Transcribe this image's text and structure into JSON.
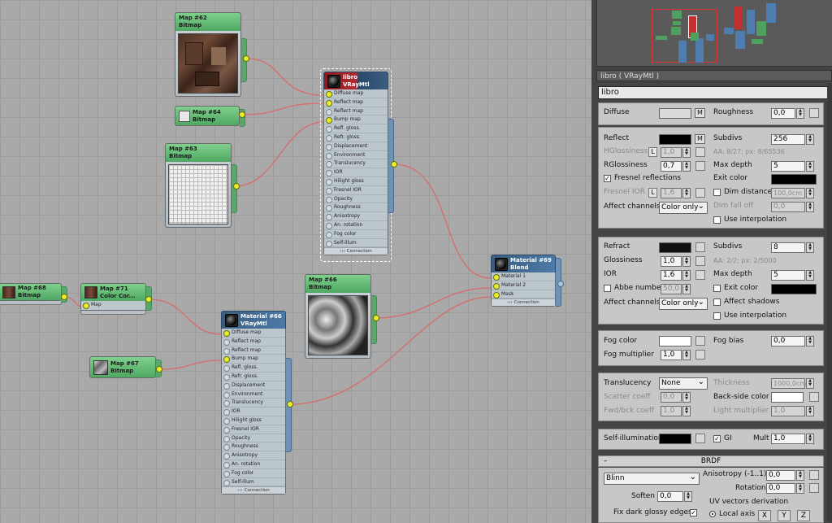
{
  "nodes": {
    "map62": {
      "title": "Map #62",
      "type": "Bitmap"
    },
    "map64": {
      "title": "Map #64",
      "type": "Bitmap"
    },
    "map63": {
      "title": "Map #63",
      "type": "Bitmap"
    },
    "map68": {
      "title": "Map #68",
      "type": "Bitmap"
    },
    "map71": {
      "title": "Map #71",
      "type": "Color Cor...",
      "slot": "Map"
    },
    "map66": {
      "title": "Map #66",
      "type": "Bitmap"
    },
    "map67": {
      "title": "Map #67",
      "type": "Bitmap"
    },
    "libro": {
      "title": "libro",
      "type": "VRayMtl"
    },
    "mat66": {
      "title": "Material #66",
      "type": "VRayMtl"
    },
    "mat69": {
      "title": "Material #69",
      "type": "Blend",
      "slots": [
        "Material 1",
        "Material 2",
        "Mask"
      ]
    },
    "vray_slots": [
      "Diffuse map",
      "Reflect map",
      "Reflect map",
      "Bump map",
      "Refl. gloss.",
      "Refr. gloss.",
      "Displacement",
      "Environment",
      "Translucency",
      "IOR",
      "Hilight gloss",
      "Fresnel IOR",
      "Opacity",
      "Roughness",
      "Anisotropy",
      "An. rotation",
      "Fog color",
      "Self-illum"
    ],
    "connection_label": "››› Connection"
  },
  "panel": {
    "title": "libro  ( VRayMtl )",
    "name": "libro",
    "diffuse": {
      "label": "Diffuse",
      "m": "M",
      "roughness_label": "Roughness",
      "roughness": "0,0"
    },
    "reflect": {
      "label": "Reflect",
      "m": "M",
      "subdivs_label": "Subdivs",
      "subdivs": "256",
      "hgloss_label": "HGlossiness",
      "hgloss_l": "L",
      "hgloss": "1,0",
      "aa": "AA: 8/27; px: 8/65536",
      "rgloss_label": "RGlossiness",
      "rgloss": "0,7",
      "maxdepth_label": "Max depth",
      "maxdepth": "5",
      "fresnel_label": "Fresnel reflections",
      "exit_label": "Exit color",
      "fior_label": "Fresnel IOR",
      "fior_l": "L",
      "fior": "1,6",
      "dim_label": "Dim distance",
      "dim": "100,0cm",
      "channels_label": "Affect channels",
      "channels": "Color only",
      "dimfall_label": "Dim fall off",
      "dimfall": "0,0",
      "interp_label": "Use interpolation"
    },
    "refract": {
      "label": "Refract",
      "subdivs_label": "Subdivs",
      "subdivs": "8",
      "gloss_label": "Glossiness",
      "gloss": "1,0",
      "aa": "AA: 2/2; px: 2/5000",
      "ior_label": "IOR",
      "ior": "1,6",
      "maxdepth_label": "Max depth",
      "maxdepth": "5",
      "abbe_label": "Abbe number",
      "abbe": "50,0",
      "exit_label": "Exit color",
      "channels_label": "Affect channels",
      "channels": "Color only",
      "shadows_label": "Affect shadows",
      "interp_label": "Use interpolation"
    },
    "fog": {
      "color_label": "Fog color",
      "bias_label": "Fog bias",
      "bias": "0,0",
      "mult_label": "Fog multiplier",
      "mult": "1,0"
    },
    "trans": {
      "label": "Translucency",
      "value": "None",
      "thick_label": "Thickness",
      "thick": "1000,0cm",
      "scatter_label": "Scatter coeff",
      "scatter": "0,0",
      "back_label": "Back-side color",
      "fwd_label": "Fwd/bck coeff",
      "fwd": "1,0",
      "light_label": "Light multiplier",
      "light": "1,0"
    },
    "selfillum": {
      "label": "Self-illumination",
      "gi_label": "GI",
      "mult_label": "Mult",
      "mult": "1,0"
    },
    "brdf": {
      "header": "BRDF",
      "collapse": "–",
      "type": "Blinn",
      "aniso_label": "Anisotropy (-1..1)",
      "aniso": "0,0",
      "rotation_label": "Rotation",
      "rotation": "0,0",
      "soften_label": "Soften",
      "soften": "0,0",
      "uv_label": "UV vectors derivation",
      "fix_label": "Fix dark glossy edges",
      "local_label": "Local axis",
      "x": "X",
      "y": "Y",
      "z": "Z"
    }
  },
  "colors": {
    "diffuse": "#d9d9d9",
    "reflect": "#000000",
    "refract": "#111111",
    "fog": "#ffffff",
    "back": "#ffffff",
    "selfillum": "#000000",
    "wire": "#d96a6a",
    "accent": "#4c7aa6"
  }
}
